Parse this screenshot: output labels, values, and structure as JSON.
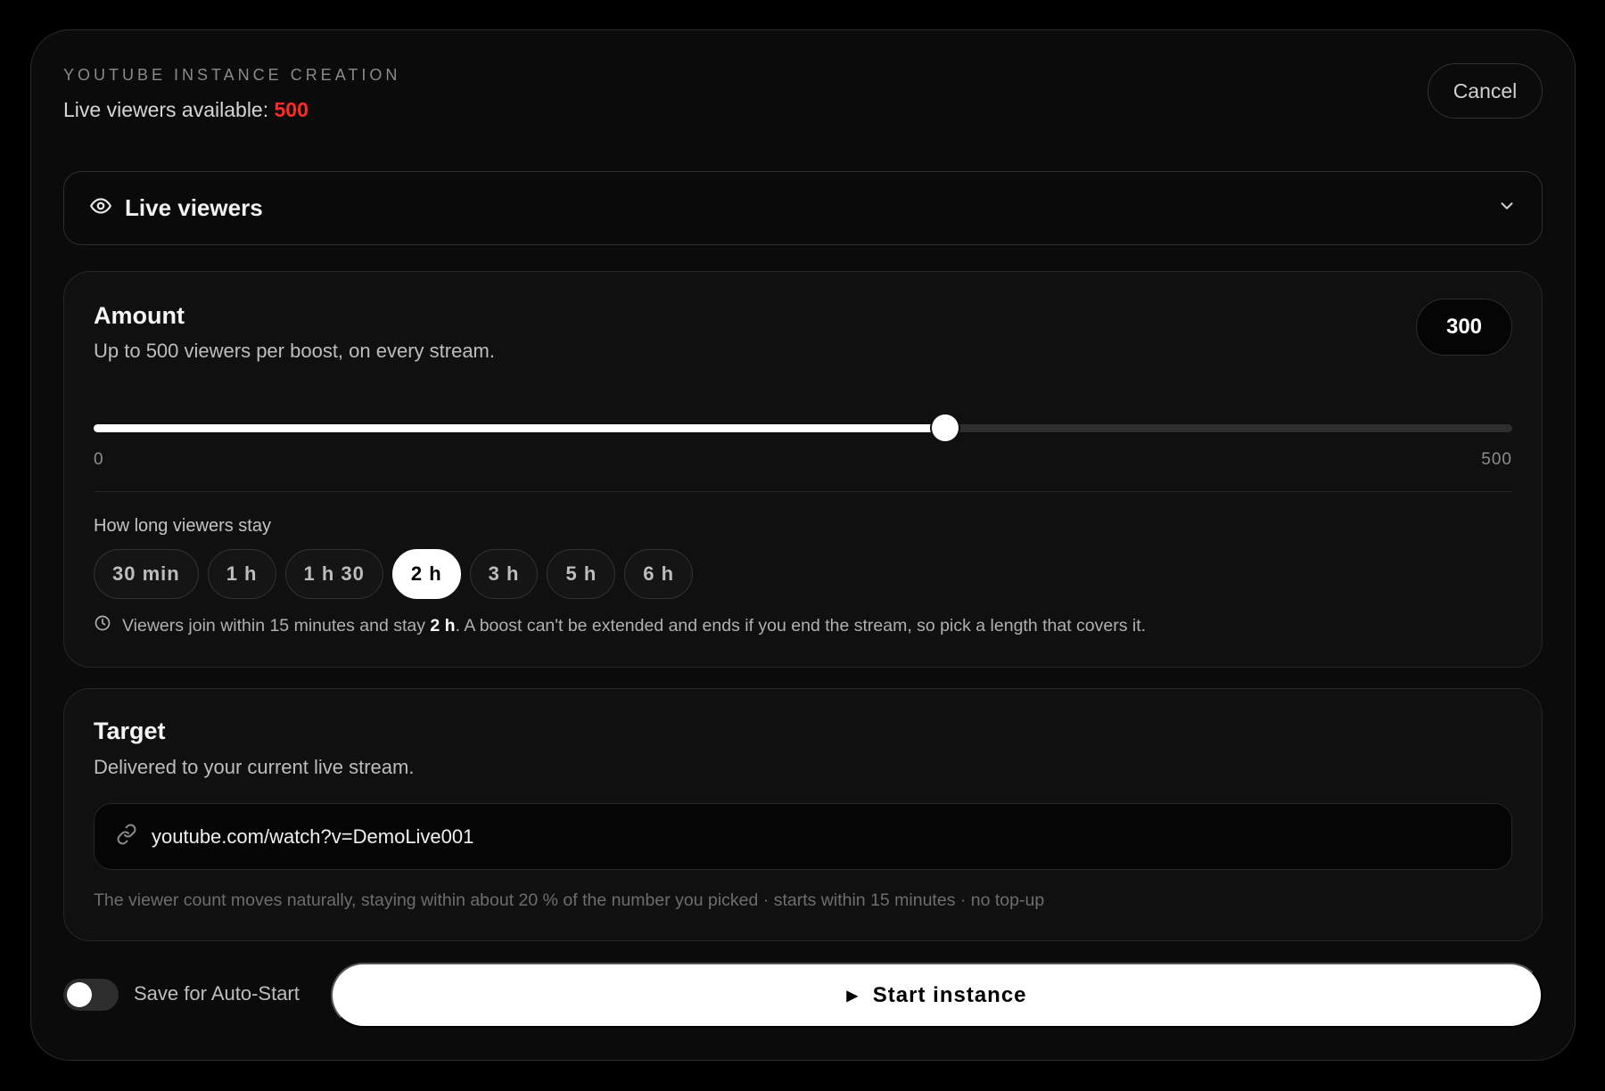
{
  "header": {
    "eyebrow": "YOUTUBE INSTANCE CREATION",
    "available_label": "Live viewers available:",
    "available_count": "500",
    "cancel_label": "Cancel"
  },
  "service": {
    "label": "Live viewers",
    "icon": "eye-icon"
  },
  "amount": {
    "title": "Amount",
    "subtitle": "Up to 500 viewers per boost, on every stream.",
    "value": "300",
    "min_label": "0",
    "max_label": "500",
    "slider": {
      "min": 0,
      "max": 500,
      "value": 300
    }
  },
  "duration": {
    "label": "How long viewers stay",
    "options": [
      "30 min",
      "1 h",
      "1 h 30",
      "2 h",
      "3 h",
      "5 h",
      "6 h"
    ],
    "selected_index": 3,
    "note_before": "Viewers join within 15 minutes and stay ",
    "note_bold": "2 h",
    "note_after": ". A boost can't be extended and ends if you end the stream, so pick a length that covers it."
  },
  "target": {
    "title": "Target",
    "subtitle": "Delivered to your current live stream.",
    "url": "youtube.com/watch?v=DemoLive001",
    "footnote": "The viewer count moves naturally, staying within about 20 % of the number you picked · starts within 15 minutes · no top-up"
  },
  "footer": {
    "toggle_label": "Save for Auto-Start",
    "toggle_on": false,
    "start_label": "Start instance"
  },
  "colors": {
    "accent_red": "#ff2a2a",
    "background": "#0b0b0b",
    "primary_button": "#ffffff"
  }
}
